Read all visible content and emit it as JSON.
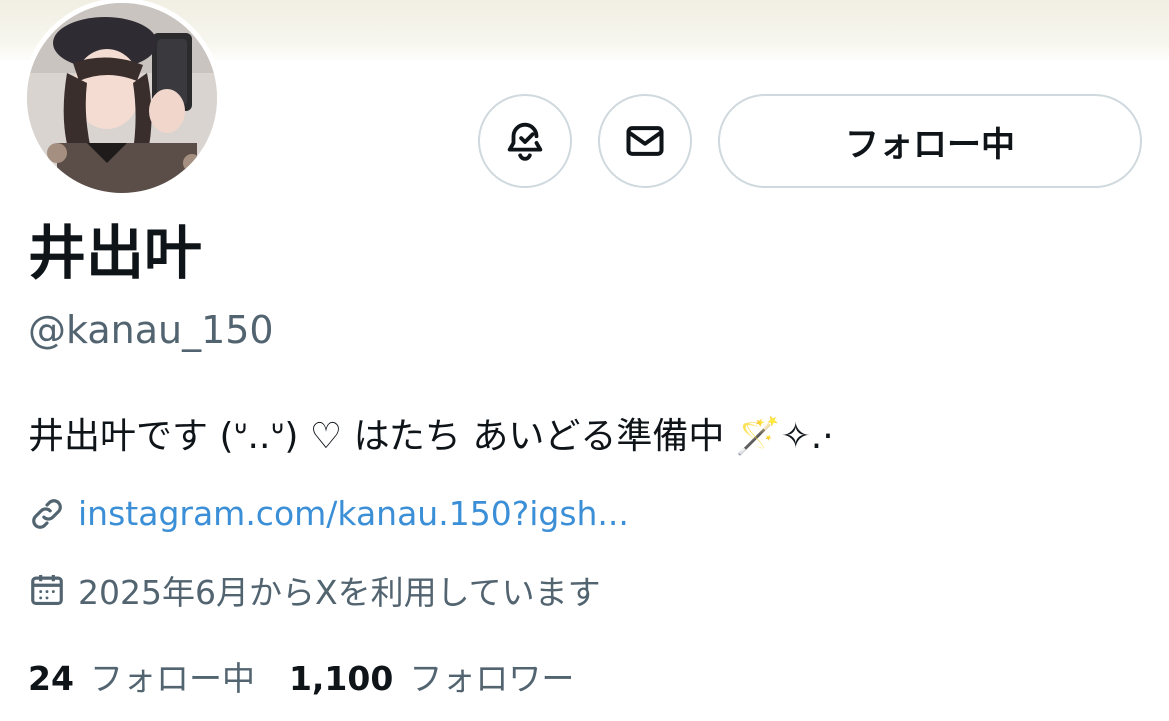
{
  "profile": {
    "display_name": "井出叶",
    "handle": "@kanau_150",
    "bio": "井出叶です (ᐡ..ᐡ) ♡ はたち あいどる準備中 🪄✧.·",
    "link": "instagram.com/kanau.150?igsh...",
    "joined": "2025年6月からXを利用しています"
  },
  "actions": {
    "notify_icon": "bell-check-icon",
    "message_icon": "mail-icon",
    "follow_label": "フォロー中"
  },
  "stats": {
    "following_count": "24",
    "following_label": "フォロー中",
    "followers_count": "1,100",
    "followers_label": "フォロワー"
  },
  "colors": {
    "link": "#3b8fd6",
    "secondary_text": "#536471",
    "border": "#cfd9de"
  }
}
